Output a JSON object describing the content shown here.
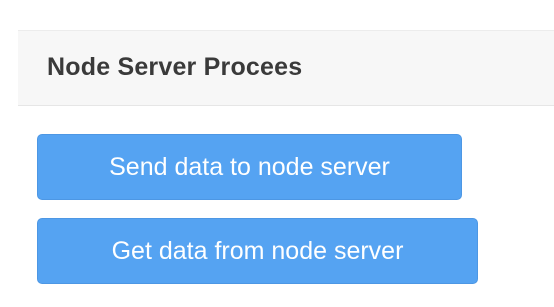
{
  "panel": {
    "title": "Node Server Procees"
  },
  "buttons": {
    "send_label": "Send data to node server",
    "get_label": "Get data from node server"
  },
  "colors": {
    "button_bg": "#55a3f2",
    "button_text": "#ffffff",
    "header_bg": "#f7f7f7",
    "title_text": "#3a3a3a"
  }
}
